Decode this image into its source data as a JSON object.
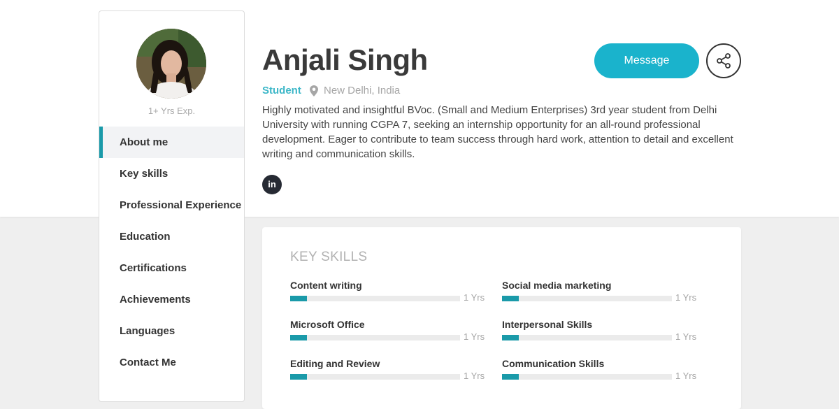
{
  "profile": {
    "name": "Anjali Singh",
    "role": "Student",
    "location": "New Delhi, India",
    "experience": "1+ Yrs Exp.",
    "bio": "Highly motivated and insightful BVoc. (Small and Medium Enterprises) 3rd year student from Delhi University with running CGPA 7, seeking an internship opportunity for an all-round professional development. Eager to contribute to team success through hard work, attention to detail and excellent writing and communication skills.",
    "linkedin_label": "in"
  },
  "actions": {
    "message_label": "Message",
    "share_icon": "share-icon"
  },
  "nav": {
    "active_index": 0,
    "items": [
      {
        "label": "About me"
      },
      {
        "label": "Key skills"
      },
      {
        "label": "Professional Experience"
      },
      {
        "label": "Education"
      },
      {
        "label": "Certifications"
      },
      {
        "label": "Achievements"
      },
      {
        "label": "Languages"
      },
      {
        "label": "Contact Me"
      }
    ]
  },
  "skills_card": {
    "title": "KEY SKILLS",
    "skills": [
      {
        "name": "Content writing",
        "years": "1 Yrs",
        "level": 0.1
      },
      {
        "name": "Social media marketing",
        "years": "1 Yrs",
        "level": 0.1
      },
      {
        "name": "Microsoft Office",
        "years": "1 Yrs",
        "level": 0.1
      },
      {
        "name": "Interpersonal Skills",
        "years": "1 Yrs",
        "level": 0.1
      },
      {
        "name": "Editing and Review",
        "years": "1 Yrs",
        "level": 0.1
      },
      {
        "name": "Communication Skills",
        "years": "1 Yrs",
        "level": 0.1
      }
    ]
  },
  "colors": {
    "accent": "#1ab3cc",
    "role": "#3cb7c8",
    "bar_fill": "#1a9aa9",
    "bar_track": "#ebebeb",
    "linkedin_bg": "#262a33"
  }
}
